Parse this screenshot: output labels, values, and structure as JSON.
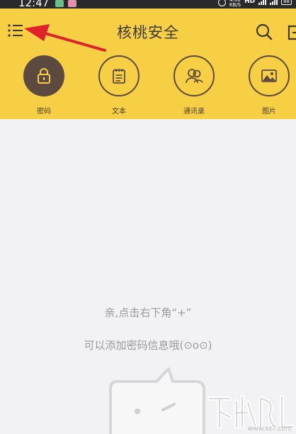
{
  "status_bar": {
    "time": "12:47",
    "network_speed": "4.00\nKB/S",
    "hd_label": "HD",
    "battery": "88"
  },
  "header": {
    "title": "核桃安全",
    "background_color": "#f7cf45"
  },
  "categories": [
    {
      "label": "密码",
      "icon": "lock-icon",
      "active": true
    },
    {
      "label": "文本",
      "icon": "notepad-icon",
      "active": false
    },
    {
      "label": "通讯录",
      "icon": "contacts-icon",
      "active": false
    },
    {
      "label": "图片",
      "icon": "image-icon",
      "active": false
    }
  ],
  "empty_state": {
    "line1": "亲,点击右下角“+”",
    "line2": "可以添加密码信息哦(⊙o⊙)"
  },
  "watermark": {
    "text": "www.xz7.com"
  }
}
